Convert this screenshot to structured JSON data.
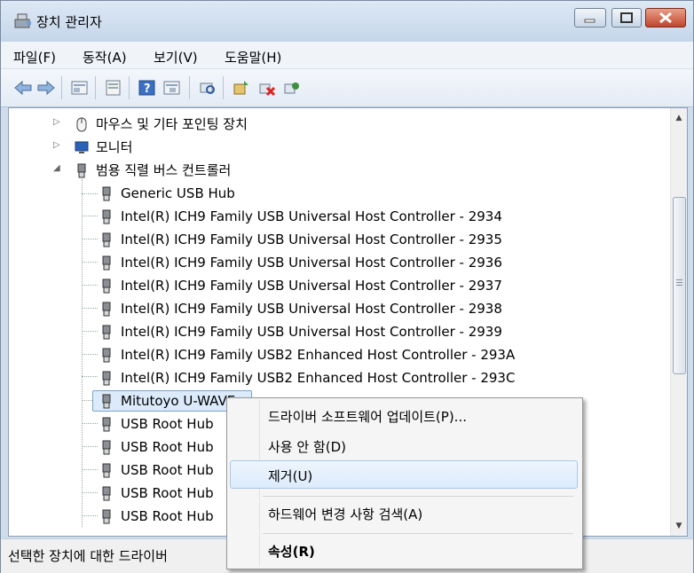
{
  "window": {
    "title": "장치 관리자"
  },
  "menubar": {
    "items": [
      "파일(F)",
      "동작(A)",
      "보기(V)",
      "도움말(H)"
    ]
  },
  "toolbar": {
    "icons": [
      "back-icon",
      "forward-icon",
      "properties-view-icon",
      "devices-view-icon",
      "help-icon",
      "resources-view-icon",
      "scan-hardware-icon",
      "update-driver-icon",
      "disable-device-icon",
      "uninstall-device-icon"
    ]
  },
  "tree": {
    "categories": [
      {
        "label": "마우스 및 기타 포인팅 장치",
        "icon": "mouse-icon",
        "expanded": false
      },
      {
        "label": "모니터",
        "icon": "monitor-icon",
        "expanded": false
      },
      {
        "label": "범용 직렬 버스 컨트롤러",
        "icon": "usb-icon",
        "expanded": true
      }
    ],
    "devices": [
      "Generic USB Hub",
      "Intel(R) ICH9 Family USB Universal Host Controller - 2934",
      "Intel(R) ICH9 Family USB Universal Host Controller - 2935",
      "Intel(R) ICH9 Family USB Universal Host Controller - 2936",
      "Intel(R) ICH9 Family USB Universal Host Controller - 2937",
      "Intel(R) ICH9 Family USB Universal Host Controller - 2938",
      "Intel(R) ICH9 Family USB Universal Host Controller - 2939",
      "Intel(R) ICH9 Family USB2 Enhanced Host Controller - 293A",
      "Intel(R) ICH9 Family USB2 Enhanced Host Controller - 293C",
      "Mitutoyo U-WAVE",
      "USB Root Hub",
      "USB Root Hub",
      "USB Root Hub",
      "USB Root Hub",
      "USB Root Hub"
    ],
    "selected_device": "Mitutoyo U-WAVE"
  },
  "context_menu": {
    "items": [
      "드라이버 소프트웨어 업데이트(P)...",
      "사용 안 함(D)",
      "제거(U)",
      "하드웨어 변경 사항 검색(A)",
      "속성(R)"
    ],
    "highlighted": "제거(U)"
  },
  "statusbar": {
    "text": "선택한 장치에 대한 드라이버 "
  }
}
